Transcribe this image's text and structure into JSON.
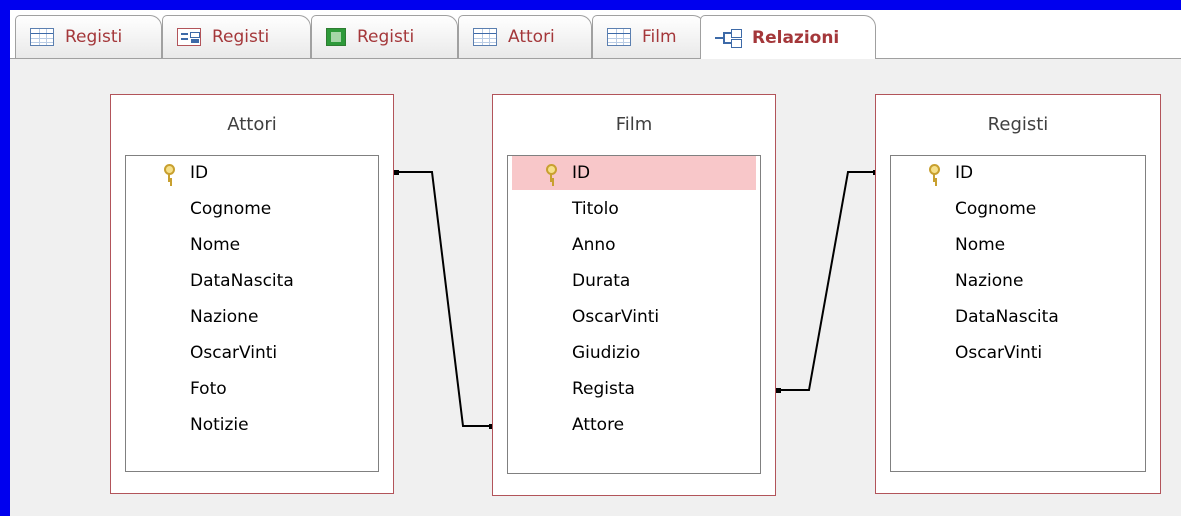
{
  "tabs": [
    {
      "label": "Registi",
      "icon": "table-icon",
      "active": false
    },
    {
      "label": "Registi",
      "icon": "form-icon",
      "active": false
    },
    {
      "label": "Registi",
      "icon": "report-icon",
      "active": false
    },
    {
      "label": "Attori",
      "icon": "table-icon",
      "active": false
    },
    {
      "label": "Film",
      "icon": "table-icon",
      "active": false
    },
    {
      "label": "Relazioni",
      "icon": "relationships-icon",
      "active": true
    }
  ],
  "tables": {
    "attori": {
      "title": "Attori",
      "fields": [
        "ID",
        "Cognome",
        "Nome",
        "DataNascita",
        "Nazione",
        "OscarVinti",
        "Foto",
        "Notizie"
      ],
      "key_field": "ID"
    },
    "film": {
      "title": "Film",
      "fields": [
        "ID",
        "Titolo",
        "Anno",
        "Durata",
        "OscarVinti",
        "Giudizio",
        "Regista",
        "Attore"
      ],
      "key_field": "ID",
      "selected_field": "ID"
    },
    "registi": {
      "title": "Registi",
      "fields": [
        "ID",
        "Cognome",
        "Nome",
        "Nazione",
        "DataNascita",
        "OscarVinti"
      ],
      "key_field": "ID"
    }
  },
  "relationships": [
    {
      "from": "Attori.ID",
      "to": "Film.Attore"
    },
    {
      "from": "Registi.ID",
      "to": "Film.Regista"
    }
  ],
  "colors": {
    "outer_border": "#0000ee",
    "table_border": "#b2545a",
    "tab_text": "#a4373a",
    "selected_row": "#f8c7c9"
  }
}
